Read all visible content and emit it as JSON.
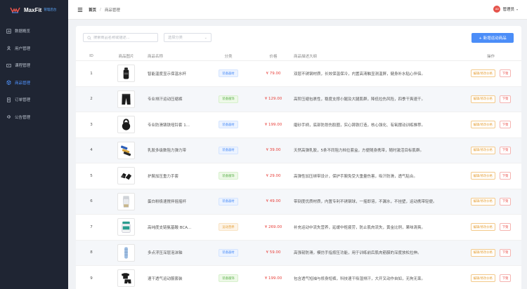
{
  "app": {
    "name": "MaxFit",
    "subtitle": "管理后台",
    "colors": {
      "sidebar_bg": "#1f2533",
      "accent": "#4b8df8",
      "price": "#e8413b"
    }
  },
  "sidebar": {
    "items": [
      {
        "label": "数据概览",
        "icon": "dashboard-icon",
        "active": false
      },
      {
        "label": "用户管理",
        "icon": "user-icon",
        "active": false
      },
      {
        "label": "课程管理",
        "icon": "course-icon",
        "active": false
      },
      {
        "label": "商品管理",
        "icon": "product-icon",
        "active": true
      },
      {
        "label": "订单管理",
        "icon": "order-icon",
        "active": false
      },
      {
        "label": "公告管理",
        "icon": "notice-icon",
        "active": false
      }
    ]
  },
  "header": {
    "breadcrumb_home": "首页",
    "breadcrumb_sep": "/",
    "breadcrumb_current": "商品管理",
    "avatar_text": "AD",
    "user_name": "管理员"
  },
  "toolbar": {
    "search_placeholder": "搜索商品名称或描述...",
    "category_placeholder": "选择分类",
    "add_button": "+ 新增运动商品"
  },
  "table": {
    "headers": [
      "ID",
      "商品图片",
      "商品名称",
      "分类",
      "价格",
      "商品描述大纲",
      "操作"
    ],
    "rows": [
      {
        "id": "1",
        "name": "智能温度显示保温水杯",
        "category": "装备器材",
        "tag": "blue",
        "price": "¥ 79.00",
        "desc": "双层不锈钢材质，长效保温保冷，内置高清触显测温屏，健身补水贴心伴侣。",
        "image": "bottle"
      },
      {
        "id": "2",
        "name": "专业排汗运动压缩裤",
        "category": "装备服饰",
        "tag": "green",
        "price": "¥ 129.00",
        "desc": "高阶压缩包裹性，稳度支撑小腿及大腿肌群，降低拉伤风险，四季干爽速干。",
        "image": "shorts"
      },
      {
        "id": "3",
        "name": "专业防滑铸铁哑铃套 1...",
        "category": "装备器材",
        "tag": "blue",
        "price": "¥ 199.00",
        "desc": "磨砂手柄，底部防划伤胶圈，实心铸铁打造，核心强化、有氧摆动训练推荐。",
        "image": "kettlebell"
      },
      {
        "id": "4",
        "name": "乳胶多级数阻力弹力带",
        "category": "装备器材",
        "tag": "blue",
        "price": "¥ 39.00",
        "desc": "天然高弹乳胶，5条不同阻力档位套盒，方便随身携带，随时激活目标肌群。",
        "image": "bands"
      },
      {
        "id": "5",
        "name": "护腕加压重力手套",
        "category": "装备服饰",
        "tag": "green",
        "price": "¥ 29.00",
        "desc": "高弹性加压绑带设计，保护手腕免受大重量伤害，吸汗防滑，透气贴合。",
        "image": "gloves"
      },
      {
        "id": "6",
        "name": "蛋白粉极速搅拌摇摇杯",
        "category": "装备器材",
        "tag": "blue",
        "price": "¥ 49.00",
        "desc": "带刻度优质材质，内置专利不锈钢球，一摇即溶，不漏水，不挂壁，运动携带轻便。",
        "image": "shaker"
      },
      {
        "id": "7",
        "name": "高纯度支链氨基酸 BCA...",
        "category": "运动营养",
        "tag": "orange",
        "price": "¥ 269.00",
        "desc": "补充运动中流失营养，延缓中枢疲劳，防止肌肉流失，黄金比例，果味清爽。",
        "image": "supplement"
      },
      {
        "id": "8",
        "name": "多点浮压深层泡沫轴",
        "category": "装备器材",
        "tag": "blue",
        "price": "¥ 59.00",
        "desc": "高强韧防滑，模仿手指按压功能，用于训练前后肌肉筋膜的深度放松拉伸。",
        "image": "roller"
      },
      {
        "id": "9",
        "name": "速干透气运动服套装",
        "category": "装备服饰",
        "tag": "green",
        "price": "¥ 199.00",
        "desc": "包含透气短袖与修身短裤，科技速干吸湿排汗，大开叉动作自如，无拘无束。",
        "image": "apparel"
      }
    ],
    "edit_label": "编辑/修改价格",
    "off_label": "下架"
  }
}
